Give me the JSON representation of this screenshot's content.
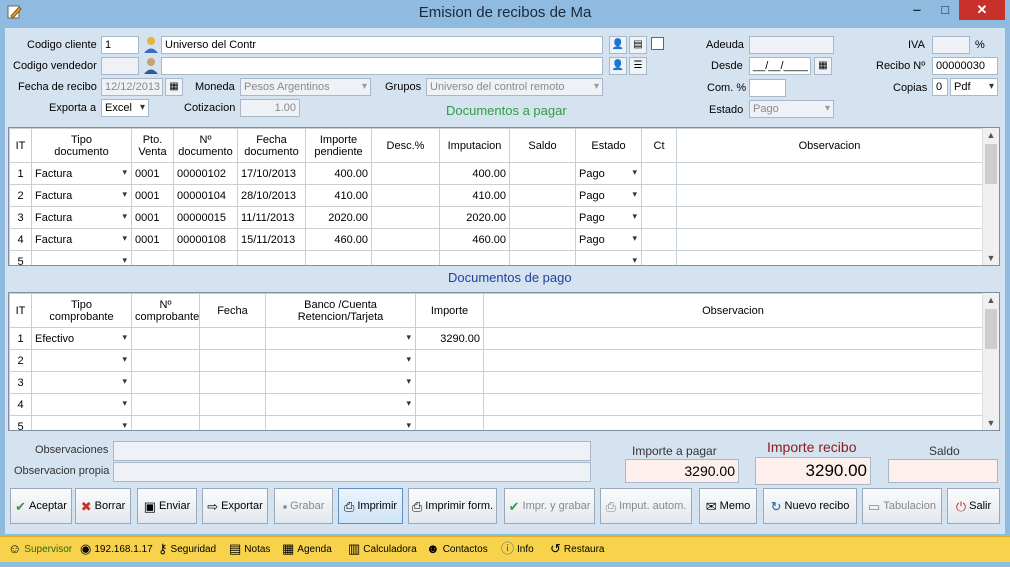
{
  "window": {
    "title": "Emision de recibos de Ma",
    "min": "‒",
    "max": "□",
    "close": "✕",
    "icon": "edit-icon"
  },
  "form": {
    "cliente_label": "Codigo cliente",
    "cliente_codigo": "1",
    "cliente_nombre": "Universo del Contr",
    "vendedor_label": "Codigo vendedor",
    "vendedor_codigo": "",
    "vendedor_nombre": "",
    "fecha_label": "Fecha de recibo",
    "fecha": "12/12/2013",
    "moneda_label": "Moneda",
    "moneda": "Pesos Argentinos",
    "grupos_label": "Grupos",
    "grupos": "Universo del control remoto",
    "exporta_label": "Exporta a",
    "exporta": "Excel",
    "cotizacion_label": "Cotizacion",
    "cotizacion": "1.00",
    "adeuda_label": "Adeuda",
    "adeuda": "",
    "desde_label": "Desde",
    "desde": "__/__/____",
    "com_label": "Com. %",
    "com": "",
    "estado_label": "Estado",
    "estado": "Pago",
    "iva_label": "IVA",
    "iva": "",
    "iva_pct": "%",
    "recibo_label": "Recibo Nº",
    "recibo": "00000030",
    "copias_label": "Copias",
    "copias": "0",
    "copias_fmt": "Pdf"
  },
  "docs_a_pagar": {
    "title": "Documentos a pagar",
    "headers": [
      "IT",
      "Tipo\ndocumento",
      "Pto.\nVenta",
      "Nº\ndocumento",
      "Fecha\ndocumento",
      "Importe\npendiente",
      "Desc.%",
      "Imputacion",
      "Saldo",
      "Estado",
      "Ct",
      "Observacion"
    ],
    "rows": [
      {
        "it": "1",
        "tipo": "Factura",
        "pto": "0001",
        "num": "00000102",
        "fecha": "17/10/2013",
        "importe": "400.00",
        "desc": "",
        "imput": "400.00",
        "saldo": "",
        "estado": "Pago",
        "ct": "",
        "obs": ""
      },
      {
        "it": "2",
        "tipo": "Factura",
        "pto": "0001",
        "num": "00000104",
        "fecha": "28/10/2013",
        "importe": "410.00",
        "desc": "",
        "imput": "410.00",
        "saldo": "",
        "estado": "Pago",
        "ct": "",
        "obs": ""
      },
      {
        "it": "3",
        "tipo": "Factura",
        "pto": "0001",
        "num": "00000015",
        "fecha": "11/11/2013",
        "importe": "2020.00",
        "desc": "",
        "imput": "2020.00",
        "saldo": "",
        "estado": "Pago",
        "ct": "",
        "obs": ""
      },
      {
        "it": "4",
        "tipo": "Factura",
        "pto": "0001",
        "num": "00000108",
        "fecha": "15/11/2013",
        "importe": "460.00",
        "desc": "",
        "imput": "460.00",
        "saldo": "",
        "estado": "Pago",
        "ct": "",
        "obs": ""
      },
      {
        "it": "5",
        "tipo": "",
        "pto": "",
        "num": "",
        "fecha": "",
        "importe": "",
        "desc": "",
        "imput": "",
        "saldo": "",
        "estado": "",
        "ct": "",
        "obs": ""
      }
    ]
  },
  "docs_de_pago": {
    "title": "Documentos de pago",
    "headers": [
      "IT",
      "Tipo\ncomprobante",
      "Nº\ncomprobante",
      "Fecha",
      "Banco /Cuenta\nRetencion/Tarjeta",
      "Importe",
      "Observacion"
    ],
    "rows": [
      {
        "it": "1",
        "tipo": "Efectivo",
        "num": "",
        "fecha": "",
        "banco": "",
        "importe": "3290.00",
        "obs": ""
      },
      {
        "it": "2",
        "tipo": "",
        "num": "",
        "fecha": "",
        "banco": "",
        "importe": "",
        "obs": ""
      },
      {
        "it": "3",
        "tipo": "",
        "num": "",
        "fecha": "",
        "banco": "",
        "importe": "",
        "obs": ""
      },
      {
        "it": "4",
        "tipo": "",
        "num": "",
        "fecha": "",
        "banco": "",
        "importe": "",
        "obs": ""
      },
      {
        "it": "5",
        "tipo": "",
        "num": "",
        "fecha": "",
        "banco": "",
        "importe": "",
        "obs": ""
      }
    ]
  },
  "footer": {
    "obs_label": "Observaciones",
    "obs": "",
    "obs_propia_label": "Observacion propia",
    "obs_propia": "",
    "importe_pagar_label": "Importe a pagar",
    "importe_pagar": "3290.00",
    "importe_recibo_label": "Importe recibo",
    "importe_recibo": "3290.00",
    "saldo_label": "Saldo",
    "saldo": ""
  },
  "buttons": [
    {
      "label": "Aceptar",
      "icon": "check-icon"
    },
    {
      "label": "Borrar",
      "icon": "x-icon"
    },
    {
      "label": "Enviar",
      "icon": "send-icon"
    },
    {
      "label": "Exportar",
      "icon": "export-icon"
    },
    {
      "label": "Grabar",
      "icon": "save-icon"
    },
    {
      "label": "Imprimir",
      "icon": "printer-icon"
    },
    {
      "label": "Imprimir form.",
      "icon": "printer-icon"
    },
    {
      "label": "Impr. y grabar",
      "icon": "check-icon"
    },
    {
      "label": "Imput. autom.",
      "icon": "printer-icon"
    },
    {
      "label": "Memo",
      "icon": "memo-icon"
    },
    {
      "label": "Nuevo recibo",
      "icon": "refresh-icon"
    },
    {
      "label": "Tabulacion",
      "icon": "tabulate-icon"
    },
    {
      "label": "Salir",
      "icon": "exit-icon"
    }
  ],
  "statusbar": [
    {
      "label": "Supervisor",
      "icon": "user-icon"
    },
    {
      "label": "192.168.1.17",
      "icon": "network-icon"
    },
    {
      "label": "Seguridad",
      "icon": "key-icon"
    },
    {
      "label": "Notas",
      "icon": "notes-icon"
    },
    {
      "label": "Agenda",
      "icon": "calendar-icon"
    },
    {
      "label": "Calculadora",
      "icon": "calculator-icon"
    },
    {
      "label": "Contactos",
      "icon": "contacts-icon"
    },
    {
      "label": "Info",
      "icon": "info-icon"
    },
    {
      "label": "Restaura",
      "icon": "restore-icon"
    }
  ],
  "colors": {
    "accent_green": "#2e9e3e",
    "accent_blue": "#1f3f9e",
    "importe_recibo_red": "#8b1a1a",
    "statusbar": "#f7d24a",
    "titlebar": "#8fbbe0"
  }
}
